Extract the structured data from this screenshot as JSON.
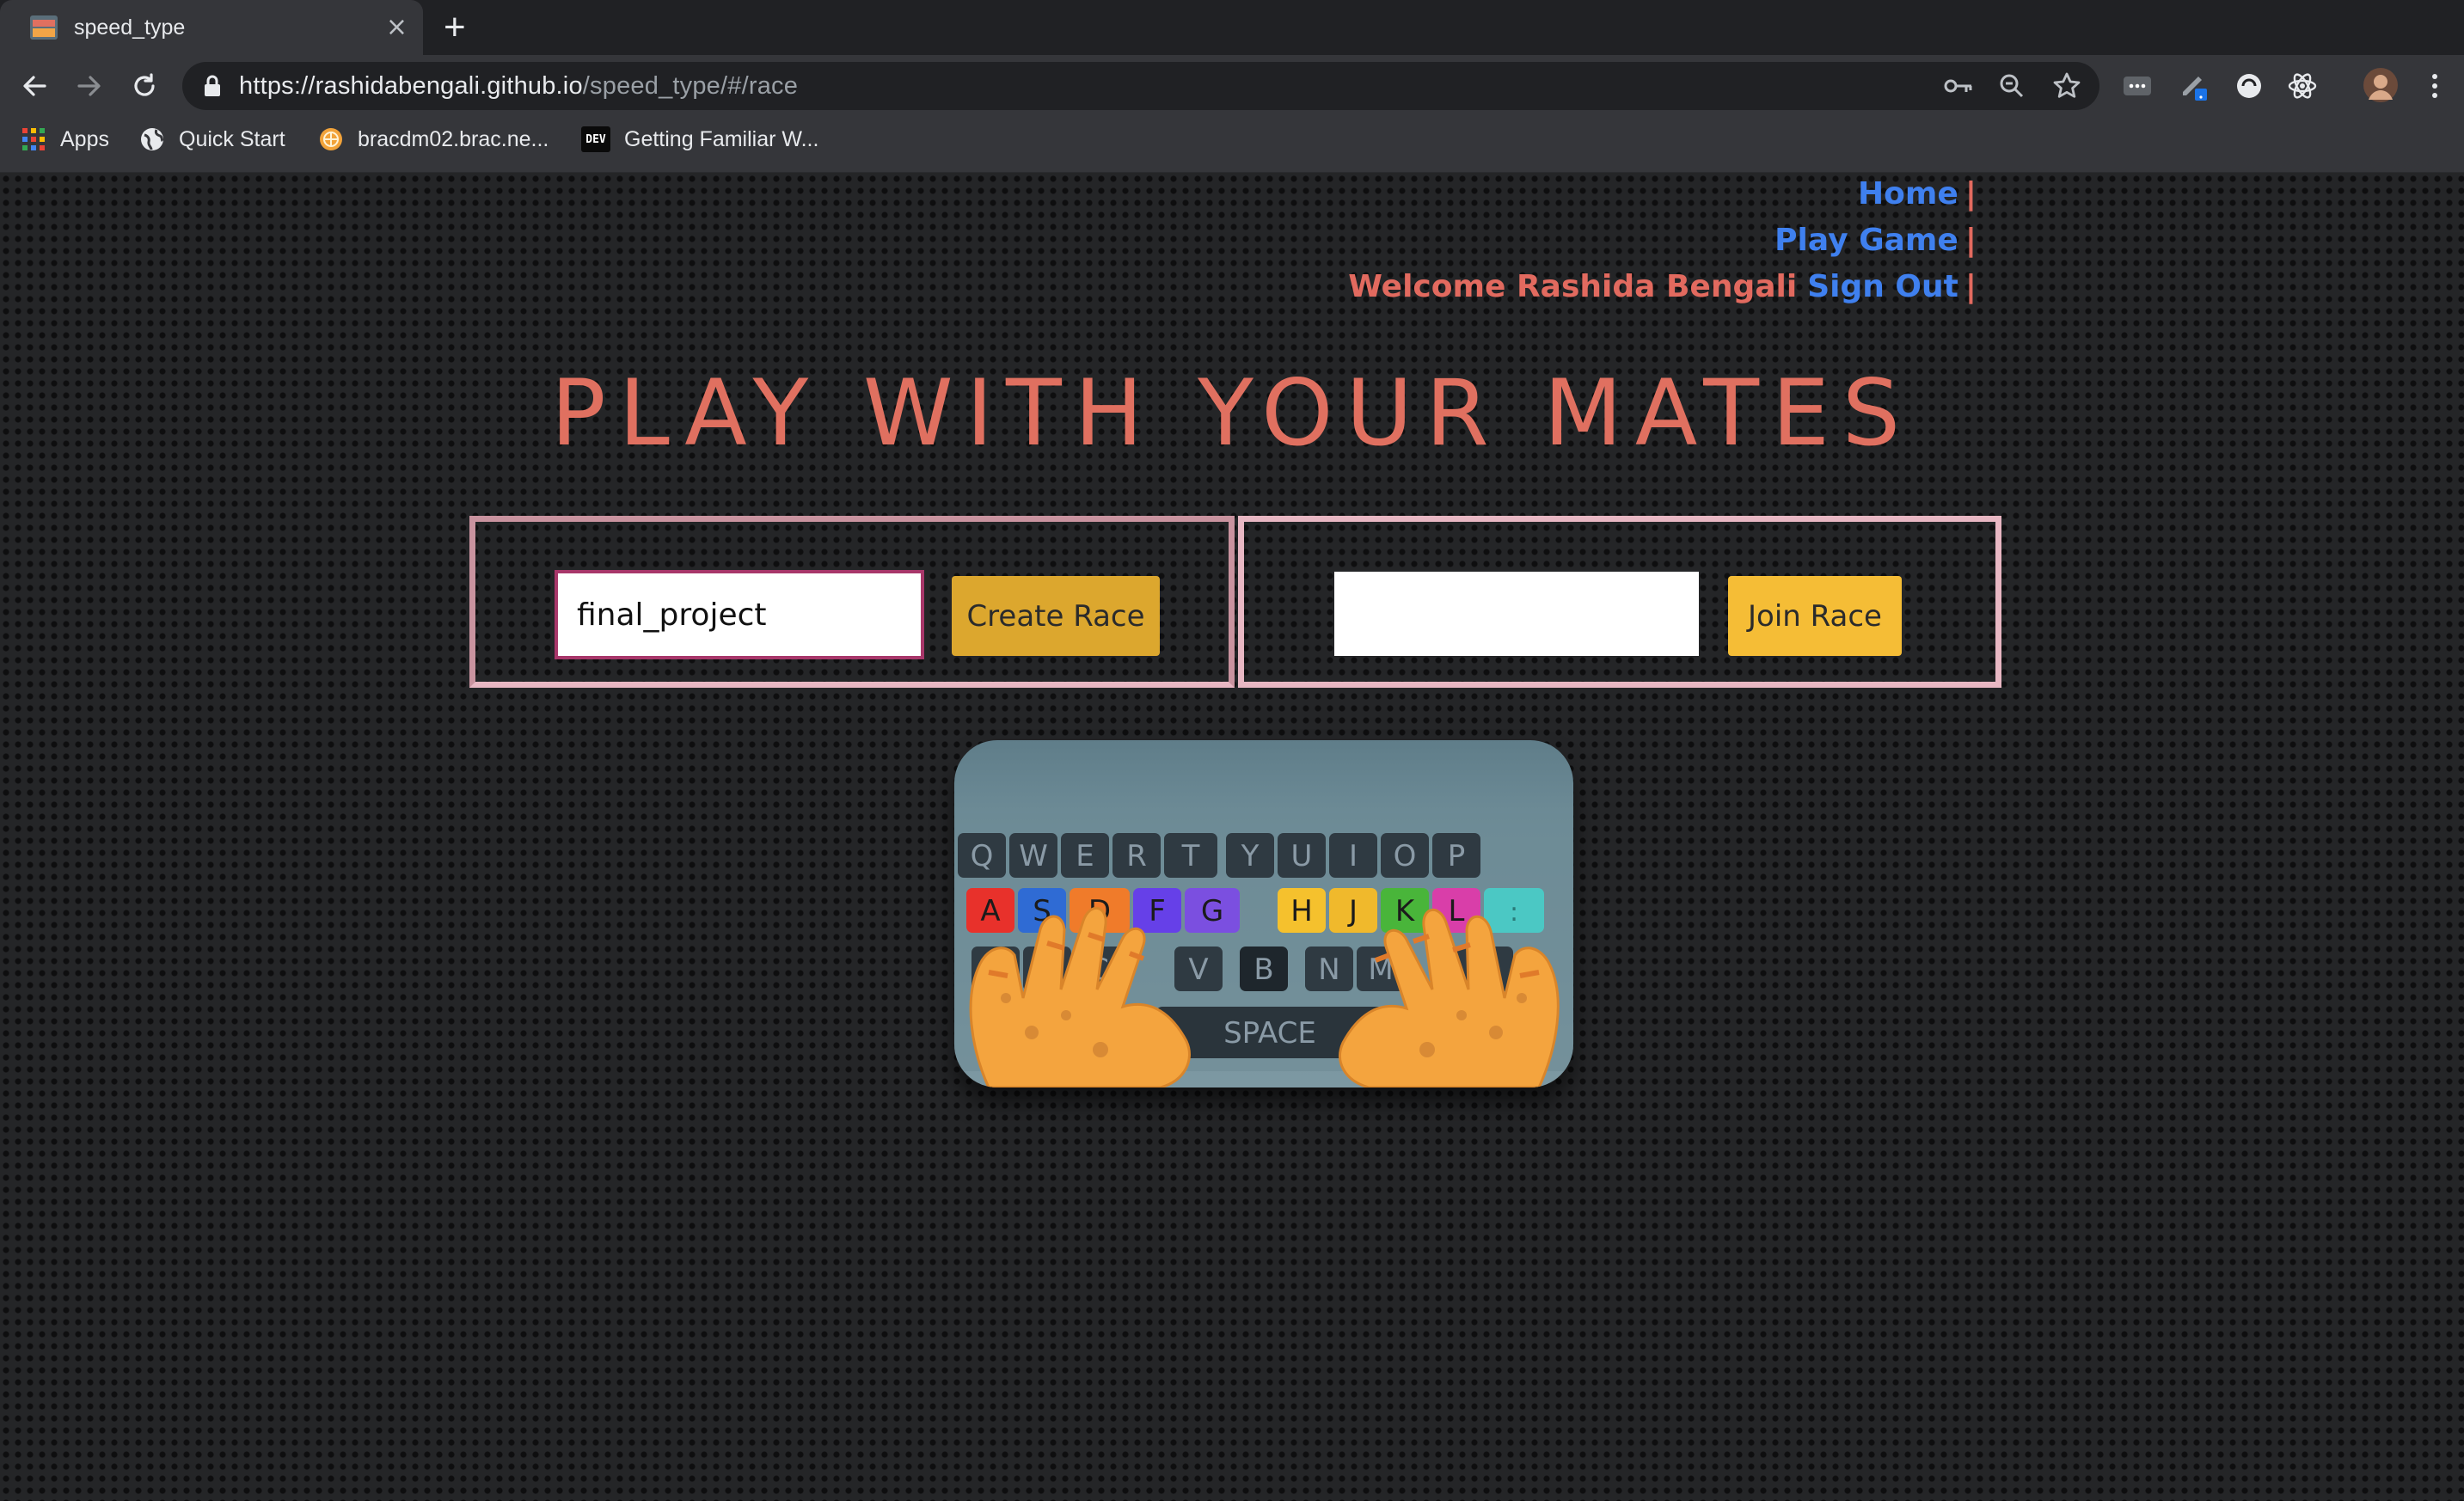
{
  "browser": {
    "tab": {
      "title": "speed_type",
      "close_glyph": "×"
    },
    "new_tab_glyph": "+",
    "url": {
      "host": "https://rashidabengali.github.io",
      "path": "/speed_type/#/race"
    },
    "bookmarks": [
      {
        "label": "Apps",
        "icon": "apps-grid-icon"
      },
      {
        "label": "Quick Start",
        "icon": "globe-icon"
      },
      {
        "label": "bracdm02.brac.ne...",
        "icon": "site-favicon-icon"
      },
      {
        "label": "Getting Familiar W...",
        "icon": "dev-badge-icon",
        "badge": "DEV"
      }
    ]
  },
  "nav": {
    "home": "Home",
    "play_game": "Play Game",
    "welcome": "Welcome Rashida Bengali",
    "sign_out": "Sign Out",
    "separator": "|"
  },
  "main": {
    "headline": "PLAY WITH YOUR MATES",
    "create": {
      "input_value": "final_project",
      "button_label": "Create Race"
    },
    "join": {
      "input_value": "",
      "button_label": "Join Race"
    }
  },
  "keyboard": {
    "row1": [
      "Q",
      "W",
      "E",
      "R",
      "T",
      "Y",
      "U",
      "I",
      "O",
      "P"
    ],
    "row2": [
      "A",
      "S",
      "D",
      "F",
      "G",
      "H",
      "J",
      "K",
      "L",
      ":"
    ],
    "row3": [
      "Z",
      "X",
      "C",
      "V",
      "B",
      "N",
      "M"
    ],
    "space": "SPACE"
  },
  "colors": {
    "accent_coral": "#e07060",
    "link_blue": "#3f80ef",
    "box_border": "#e8b7c3",
    "create_button": "#dca72e",
    "join_button": "#f5bd36"
  }
}
